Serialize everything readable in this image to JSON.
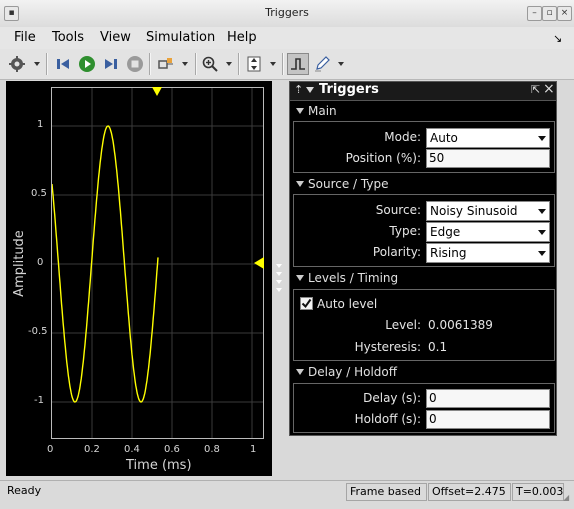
{
  "window": {
    "title": "Triggers"
  },
  "menu": [
    "File",
    "Tools",
    "View",
    "Simulation",
    "Help"
  ],
  "plot": {
    "ylabel": "Amplitude",
    "xlabel": "Time (ms)",
    "yticks": [
      "1",
      "0.5",
      "0",
      "-0.5",
      "-1"
    ],
    "xticks": [
      "0",
      "0.2",
      "0.4",
      "0.6",
      "0.8",
      "1"
    ],
    "trace_color": "#ffff00"
  },
  "panel": {
    "title": "Triggers",
    "main": {
      "section": "Main",
      "mode_label": "Mode:",
      "mode_value": "Auto",
      "position_label": "Position (%):",
      "position_value": "50"
    },
    "source_type": {
      "section": "Source / Type",
      "source_label": "Source:",
      "source_value": "Noisy Sinusoid",
      "type_label": "Type:",
      "type_value": "Edge",
      "polarity_label": "Polarity:",
      "polarity_value": "Rising"
    },
    "levels": {
      "section": "Levels / Timing",
      "auto_level_label": "Auto level",
      "auto_level_checked": true,
      "level_label": "Level:",
      "level_value": "0.0061389",
      "hysteresis_label": "Hysteresis:",
      "hysteresis_value": "0.1"
    },
    "delay": {
      "section": "Delay / Holdoff",
      "delay_label": "Delay (s):",
      "delay_value": "0",
      "holdoff_label": "Holdoff (s):",
      "holdoff_value": "0"
    }
  },
  "status": {
    "left": "Ready",
    "frame": "Frame based",
    "offset": "Offset=2.475",
    "time": "T=0.003"
  }
}
